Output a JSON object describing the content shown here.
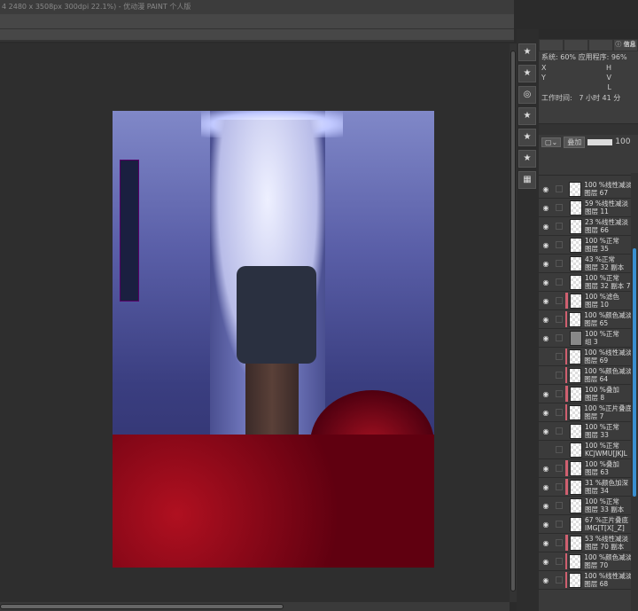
{
  "window": {
    "title": "4 2480 x 3508px 300dpi 22.1%) - 优动漫 PAINT 个人版"
  },
  "info_panel": {
    "tab": "信息",
    "system": "系统: 60%",
    "app": "应用程序: 96%",
    "x": "X",
    "y": "Y",
    "h": "H",
    "v": "V",
    "l": "L",
    "work_time_label": "工作时间:",
    "work_time": "7 小时 41 分"
  },
  "layer_panel": {
    "blend_mode": "叠加",
    "opacity": "100",
    "layers": [
      {
        "mode": "100 %线性减淡",
        "name": "图层 67",
        "visible": true,
        "clip": false
      },
      {
        "mode": "59 %线性减淡",
        "name": "图层 11",
        "visible": true,
        "clip": false
      },
      {
        "mode": "23 %线性减淡",
        "name": "图层 66",
        "visible": true,
        "clip": false
      },
      {
        "mode": "100 %正常",
        "name": "图层 35",
        "visible": true,
        "clip": false
      },
      {
        "mode": "43 %正常",
        "name": "图层 32 副本",
        "visible": true,
        "clip": false
      },
      {
        "mode": "100 %正常",
        "name": "图层 32 副本 7",
        "visible": true,
        "clip": false
      },
      {
        "mode": "100 %滤色",
        "name": "图层 10",
        "visible": true,
        "clip": true
      },
      {
        "mode": "100 %颜色减淡",
        "name": "图层 65",
        "visible": true,
        "clip": true
      },
      {
        "mode": "100 %正常",
        "name": "组 3",
        "visible": true,
        "clip": false,
        "folder": true
      },
      {
        "mode": "100 %线性减淡",
        "name": "图层 69",
        "visible": false,
        "clip": true
      },
      {
        "mode": "100 %颜色减淡",
        "name": "图层 64",
        "visible": false,
        "clip": true
      },
      {
        "mode": "100 %叠加",
        "name": "图层 8",
        "visible": true,
        "clip": true
      },
      {
        "mode": "100 %正片叠底",
        "name": "图层 7",
        "visible": true,
        "clip": true
      },
      {
        "mode": "100 %正常",
        "name": "图层 33",
        "visible": true,
        "clip": false
      },
      {
        "mode": "100 %正常",
        "name": "KCJWMU[JKJL",
        "visible": false,
        "clip": false
      },
      {
        "mode": "100 %叠加",
        "name": "图层 63",
        "visible": true,
        "clip": true
      },
      {
        "mode": "31 %颜色加深",
        "name": "图层 34",
        "visible": true,
        "clip": true
      },
      {
        "mode": "100 %正常",
        "name": "图层 33 副本",
        "visible": true,
        "clip": false
      },
      {
        "mode": "67 %正片叠底",
        "name": "IMG[T[X[_Z]",
        "visible": true,
        "clip": false
      },
      {
        "mode": "53 %线性减淡",
        "name": "图层 70 副本",
        "visible": true,
        "clip": true
      },
      {
        "mode": "100 %颜色减淡",
        "name": "图层 70",
        "visible": true,
        "clip": true
      },
      {
        "mode": "100 %线性减淡",
        "name": "图层 68",
        "visible": true,
        "clip": true
      }
    ]
  }
}
